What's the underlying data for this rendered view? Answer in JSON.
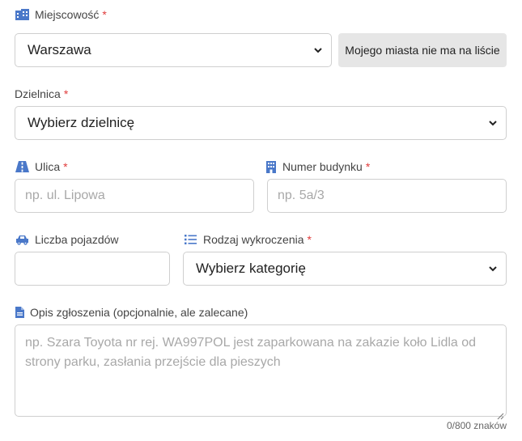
{
  "city": {
    "label": "Miejscowość",
    "required_mark": "*",
    "selected": "Warszawa",
    "missing_button": "Mojego miasta nie ma na liście"
  },
  "district": {
    "label": "Dzielnica",
    "required_mark": "*",
    "selected": "Wybierz dzielnicę"
  },
  "street": {
    "label": "Ulica",
    "required_mark": "*",
    "placeholder": "np. ul. Lipowa"
  },
  "building": {
    "label": "Numer budynku",
    "required_mark": "*",
    "placeholder": "np. 5a/3"
  },
  "vehicles": {
    "label": "Liczba pojazdów",
    "value": ""
  },
  "violation": {
    "label": "Rodzaj wykroczenia",
    "required_mark": "*",
    "selected": "Wybierz kategorię"
  },
  "description": {
    "label": "Opis zgłoszenia (opcjonalnie, ale zalecane)",
    "placeholder": "np. Szara Toyota nr rej. WA997POL jest zaparkowana na zakazie koło Lidla od strony parku, zasłania przejście dla pieszych",
    "counter": "0/800 znaków"
  },
  "colors": {
    "icon": "#4a78c9",
    "required": "#e03b3b",
    "border": "#cfcfcf"
  }
}
